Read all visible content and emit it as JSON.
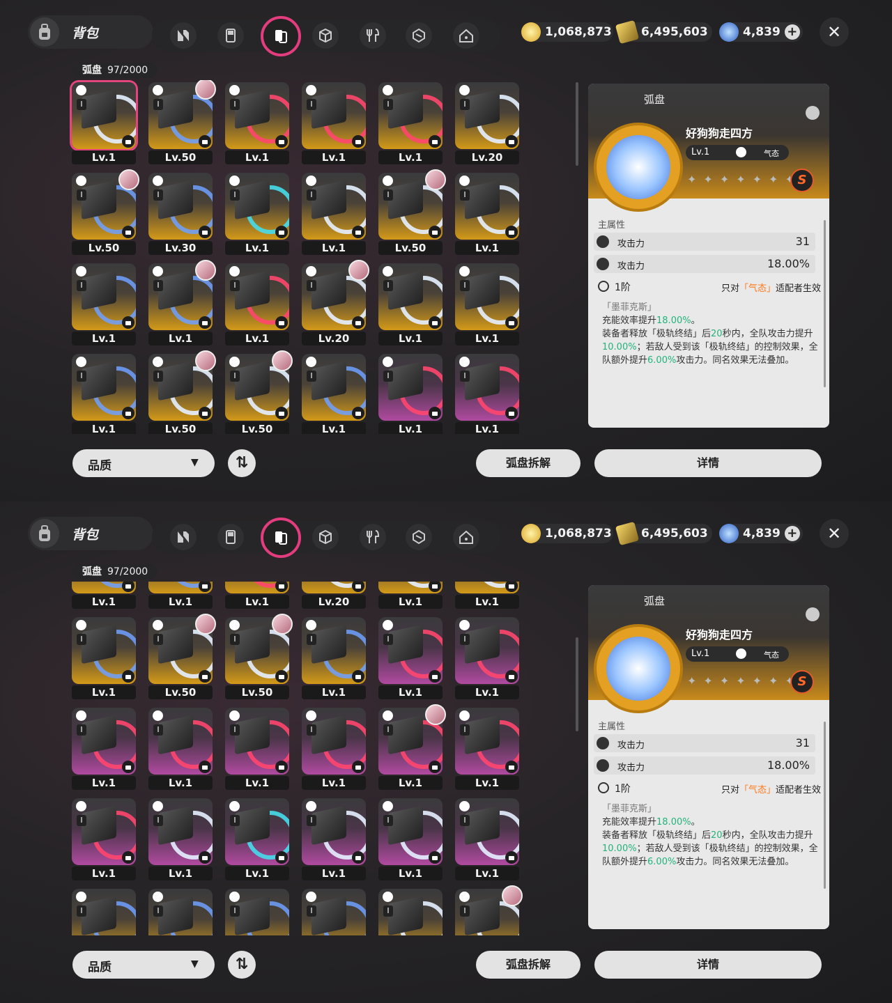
{
  "header": {
    "bag_title": "背包",
    "tabs": [
      "agents-tab",
      "bangboo-tab",
      "drive-disc-tab",
      "materials-tab",
      "food-tab",
      "w-engine-tab",
      "home-tab"
    ],
    "active_tab": 2,
    "currencies": [
      {
        "name": "coin-icon",
        "value": "1,068,873",
        "color": "#e8c24a"
      },
      {
        "name": "film-icon",
        "value": "6,495,603",
        "color": "#e5c84a"
      },
      {
        "name": "polychrome-icon",
        "value": "4,839",
        "color": "#3b7bdc"
      }
    ],
    "close_label": "✕"
  },
  "count": {
    "label": "弧盘",
    "value": "97/2000"
  },
  "panel1": {
    "rows": [
      [
        {
          "lv": "Lv.1",
          "bg": "gold",
          "ring": "white",
          "avatar": false,
          "selected": true
        },
        {
          "lv": "Lv.50",
          "bg": "gold",
          "ring": "blue",
          "avatar": true
        },
        {
          "lv": "Lv.1",
          "bg": "gold",
          "ring": "red",
          "avatar": false
        },
        {
          "lv": "Lv.1",
          "bg": "gold",
          "ring": "red",
          "avatar": false
        },
        {
          "lv": "Lv.1",
          "bg": "gold",
          "ring": "red",
          "avatar": false
        },
        {
          "lv": "Lv.20",
          "bg": "gold",
          "ring": "white",
          "avatar": false
        }
      ],
      [
        {
          "lv": "Lv.50",
          "bg": "gold",
          "ring": "blue",
          "avatar": true
        },
        {
          "lv": "Lv.30",
          "bg": "gold",
          "ring": "blue",
          "avatar": false
        },
        {
          "lv": "Lv.1",
          "bg": "gold",
          "ring": "cyan",
          "avatar": false
        },
        {
          "lv": "Lv.1",
          "bg": "gold",
          "ring": "white",
          "avatar": false
        },
        {
          "lv": "Lv.50",
          "bg": "gold",
          "ring": "white",
          "avatar": true
        },
        {
          "lv": "Lv.1",
          "bg": "gold",
          "ring": "white",
          "avatar": false
        }
      ],
      [
        {
          "lv": "Lv.1",
          "bg": "gold",
          "ring": "blue",
          "avatar": false
        },
        {
          "lv": "Lv.1",
          "bg": "gold",
          "ring": "blue",
          "avatar": true
        },
        {
          "lv": "Lv.1",
          "bg": "gold",
          "ring": "red",
          "avatar": false
        },
        {
          "lv": "Lv.20",
          "bg": "gold",
          "ring": "white",
          "avatar": true
        },
        {
          "lv": "Lv.1",
          "bg": "gold",
          "ring": "white",
          "avatar": false
        },
        {
          "lv": "Lv.1",
          "bg": "gold",
          "ring": "white",
          "avatar": false
        }
      ],
      [
        {
          "lv": "Lv.1",
          "bg": "gold",
          "ring": "blue",
          "avatar": false
        },
        {
          "lv": "Lv.50",
          "bg": "gold",
          "ring": "white",
          "avatar": true
        },
        {
          "lv": "Lv.50",
          "bg": "gold",
          "ring": "white",
          "avatar": true
        },
        {
          "lv": "Lv.1",
          "bg": "gold",
          "ring": "blue",
          "avatar": false
        },
        {
          "lv": "Lv.1",
          "bg": "purple",
          "ring": "red",
          "avatar": false
        },
        {
          "lv": "Lv.1",
          "bg": "purple",
          "ring": "red",
          "avatar": false
        }
      ]
    ]
  },
  "panel2": {
    "rows": [
      [
        {
          "lv": "Lv.1",
          "bg": "gold",
          "ring": "blue",
          "avatar": false
        },
        {
          "lv": "Lv.1",
          "bg": "gold",
          "ring": "blue",
          "avatar": false
        },
        {
          "lv": "Lv.1",
          "bg": "gold",
          "ring": "red",
          "avatar": false
        },
        {
          "lv": "Lv.20",
          "bg": "gold",
          "ring": "white",
          "avatar": false
        },
        {
          "lv": "Lv.1",
          "bg": "gold",
          "ring": "white",
          "avatar": false
        },
        {
          "lv": "Lv.1",
          "bg": "gold",
          "ring": "white",
          "avatar": false
        }
      ],
      [
        {
          "lv": "Lv.1",
          "bg": "gold",
          "ring": "blue",
          "avatar": false
        },
        {
          "lv": "Lv.50",
          "bg": "gold",
          "ring": "white",
          "avatar": true
        },
        {
          "lv": "Lv.50",
          "bg": "gold",
          "ring": "white",
          "avatar": true
        },
        {
          "lv": "Lv.1",
          "bg": "gold",
          "ring": "blue",
          "avatar": false
        },
        {
          "lv": "Lv.1",
          "bg": "purple",
          "ring": "red",
          "avatar": false
        },
        {
          "lv": "Lv.1",
          "bg": "purple",
          "ring": "red",
          "avatar": false
        }
      ],
      [
        {
          "lv": "Lv.1",
          "bg": "purple",
          "ring": "red",
          "avatar": false
        },
        {
          "lv": "Lv.1",
          "bg": "purple",
          "ring": "red",
          "avatar": false
        },
        {
          "lv": "Lv.1",
          "bg": "purple",
          "ring": "red",
          "avatar": false
        },
        {
          "lv": "Lv.1",
          "bg": "purple",
          "ring": "red",
          "avatar": false
        },
        {
          "lv": "Lv.1",
          "bg": "purple",
          "ring": "red",
          "avatar": true
        },
        {
          "lv": "Lv.1",
          "bg": "purple",
          "ring": "red",
          "avatar": false
        }
      ],
      [
        {
          "lv": "Lv.1",
          "bg": "purple",
          "ring": "red",
          "avatar": false
        },
        {
          "lv": "Lv.1",
          "bg": "purple",
          "ring": "white",
          "avatar": false
        },
        {
          "lv": "Lv.1",
          "bg": "purple",
          "ring": "cyan",
          "avatar": false
        },
        {
          "lv": "Lv.1",
          "bg": "purple",
          "ring": "white",
          "avatar": false
        },
        {
          "lv": "Lv.1",
          "bg": "purple",
          "ring": "white",
          "avatar": false
        },
        {
          "lv": "Lv.1",
          "bg": "purple",
          "ring": "white",
          "avatar": false
        }
      ],
      [
        {
          "lv": "",
          "bg": "gold",
          "ring": "blue",
          "avatar": false
        },
        {
          "lv": "",
          "bg": "gold",
          "ring": "blue",
          "avatar": false
        },
        {
          "lv": "",
          "bg": "gold",
          "ring": "blue",
          "avatar": false
        },
        {
          "lv": "",
          "bg": "gold",
          "ring": "blue",
          "avatar": false
        },
        {
          "lv": "",
          "bg": "gold",
          "ring": "white",
          "avatar": false
        },
        {
          "lv": "",
          "bg": "gold",
          "ring": "white",
          "avatar": true
        }
      ]
    ]
  },
  "detail": {
    "category": "弧盘",
    "name": "好狗狗走四方",
    "level": "Lv.1",
    "attribute": "气态",
    "stars": "✦✦✦✦✦✦✦",
    "rank": "S",
    "main_attr_label": "主属性",
    "attrs": [
      {
        "name": "攻击力",
        "value": "31"
      },
      {
        "name": "攻击力",
        "value": "18.00%"
      }
    ],
    "tier": "1阶",
    "only_prefix": "只对",
    "only_attr": "「气态」",
    "only_suffix": "适配者生效",
    "effect_source": "「墨菲克斯」",
    "effect_1a": "充能效率提升",
    "effect_1b": "18.00%",
    "effect_1c": "。",
    "effect_2a": "装备者释放「极轨终结」后",
    "effect_2b": "20",
    "effect_2c": "秒内，全队攻击力提升",
    "effect_2d": "10.00%",
    "effect_2e": "；若敌人受到该「极轨终结」的控制效果，全队额外提升",
    "effect_2f": "6.00%",
    "effect_2g": "攻击力。同名效果无法叠加。"
  },
  "footer": {
    "quality_label": "品质",
    "quality_arrow": "▼",
    "sort_label": "⇅",
    "dismantle_label": "弧盘拆解",
    "detail_label": "详情"
  }
}
